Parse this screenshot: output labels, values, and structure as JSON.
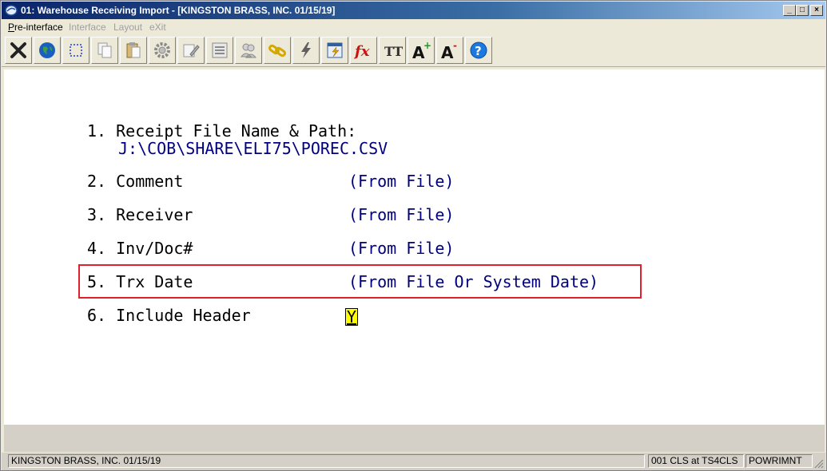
{
  "window": {
    "title": "01: Warehouse Receiving Import - [KINGSTON BRASS, INC. 01/15/19]",
    "minimize": "_",
    "maximize": "□",
    "close": "×"
  },
  "menu": {
    "items": [
      {
        "label": "Pre-interface",
        "enabled": true
      },
      {
        "label": "Interface",
        "enabled": false
      },
      {
        "label": "Layout",
        "enabled": false
      },
      {
        "label": "eXit",
        "enabled": false
      }
    ]
  },
  "toolbar": {
    "buttons": [
      "exit-icon",
      "globe-icon",
      "select-icon",
      "copy-icon",
      "paste-icon",
      "settings-icon",
      "edit-icon",
      "list-icon",
      "users-icon",
      "link-icon",
      "lightning-icon",
      "calculator-icon",
      "function-icon",
      "font-icon",
      "increase-font-icon",
      "decrease-font-icon",
      "help-icon"
    ],
    "fx": "fx",
    "tt": "TT",
    "a": "A",
    "plus": "+",
    "minus": "-",
    "help": "?"
  },
  "form": {
    "field1_label": "1. Receipt File Name & Path:",
    "field1_value": "J:\\COB\\SHARE\\ELI75\\POREC.CSV",
    "field2_label": "2. Comment",
    "field2_value": "(From File)",
    "field3_label": "3. Receiver",
    "field3_value": "(From File)",
    "field4_label": "4. Inv/Doc#",
    "field4_value": "(From File)",
    "field5_label": "5. Trx Date",
    "field5_value": "(From File Or System Date)",
    "field6_label": "6. Include Header",
    "field6_value": "Y"
  },
  "status": {
    "company": "KINGSTON BRASS, INC. 01/15/19",
    "session": "001 CLS at TS4CLS",
    "program": "POWRIMNT"
  },
  "colors": {
    "title_bar": "#0a246a",
    "field_value": "#000080",
    "highlight_border": "#e0202a",
    "input_background": "#ffff00"
  }
}
